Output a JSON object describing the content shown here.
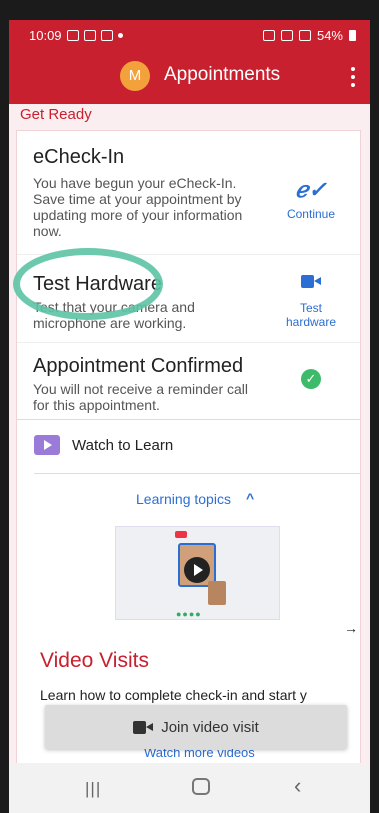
{
  "status_bar": {
    "time": "10:09",
    "battery": "54%"
  },
  "app_bar": {
    "avatar_initial": "M",
    "title": "Appointments"
  },
  "section_label": "Get Ready",
  "checklist": [
    {
      "title": "eCheck-In",
      "description": "You have begun your eCheck-In. Save time at your appointment by updating more of your information now.",
      "action_label": "Continue",
      "icon": "signature-icon"
    },
    {
      "title": "Test Hardware",
      "description": "Test that your camera and microphone are working.",
      "action_label": "Test hardware",
      "icon": "camera-icon"
    },
    {
      "title": "Appointment Confirmed",
      "description": "You will not receive a reminder call for this appointment.",
      "icon": "check-circle-icon"
    }
  ],
  "learn": {
    "title": "Watch to Learn",
    "topics_label": "Learning topics",
    "arrow": "→",
    "video_title": "Video Visits",
    "video_description": "Learn how to complete check-in and start y",
    "watch_more": "Watch more videos"
  },
  "join_button": {
    "label": "Join video visit"
  },
  "colors": {
    "primary": "#c8202e",
    "link": "#2b6ed4",
    "success": "#3dbb6b",
    "highlight": "#5cc3a5",
    "avatar": "#f3a13b"
  }
}
